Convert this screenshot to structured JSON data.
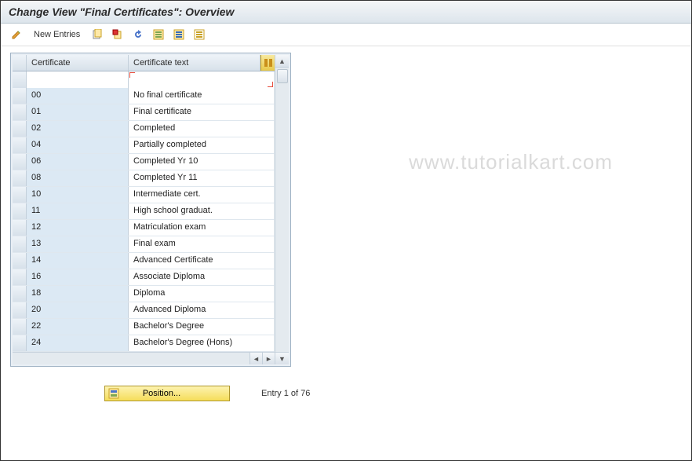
{
  "header": {
    "title": "Change View \"Final Certificates\": Overview"
  },
  "toolbar": {
    "new_entries": "New Entries"
  },
  "table": {
    "headers": {
      "certificate": "Certificate",
      "certificate_text": "Certificate text"
    },
    "rows": [
      {
        "code": "00",
        "text": "No final certificate"
      },
      {
        "code": "01",
        "text": "Final certificate"
      },
      {
        "code": "02",
        "text": "Completed"
      },
      {
        "code": "04",
        "text": "Partially completed"
      },
      {
        "code": "06",
        "text": "Completed Yr 10"
      },
      {
        "code": "08",
        "text": "Completed Yr 11"
      },
      {
        "code": "10",
        "text": "Intermediate cert."
      },
      {
        "code": "11",
        "text": "High school graduat."
      },
      {
        "code": "12",
        "text": "Matriculation exam"
      },
      {
        "code": "13",
        "text": "Final exam"
      },
      {
        "code": "14",
        "text": "Advanced Certificate"
      },
      {
        "code": "16",
        "text": "Associate Diploma"
      },
      {
        "code": "18",
        "text": "Diploma"
      },
      {
        "code": "20",
        "text": "Advanced Diploma"
      },
      {
        "code": "22",
        "text": "Bachelor's Degree"
      },
      {
        "code": "24",
        "text": "Bachelor's Degree (Hons)"
      }
    ]
  },
  "footer": {
    "position_label": "Position...",
    "entry_text": "Entry 1 of 76"
  },
  "watermark": "www.tutorialkart.com"
}
